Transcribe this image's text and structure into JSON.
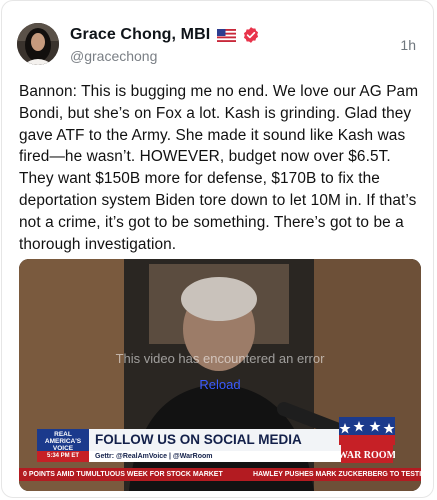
{
  "post": {
    "author_name": "Grace Chong, MBI",
    "handle": "@gracechong",
    "timestamp": "1h",
    "text": "Bannon: This is bugging me no end. We love our AG Pam Bondi, but she’s on Fox a lot. Kash is grinding. Glad they gave ATF to the Army. She made it sound like Kash was fired—he wasn’t. HOWEVER, budget now over $6.5T. They want $150B more for defense, $170B to fix the deportation system Biden tore down to let 10M in. If that’s not a crime, it’s got to be something. There’s got to be a thorough investigation."
  },
  "media": {
    "error_text": "This video has encountered an error",
    "reload_label": "Reload",
    "chyron": {
      "logo_text": "REAL AMERICA'S VOICE",
      "headline": "FOLLOW US ON SOCIAL MEDIA",
      "time": "5:34 PM ET",
      "social": "Gettr: @RealAmVoice  |  @WarRoom",
      "ticker_left": "0 POINTS AMID TUMULTUOUS WEEK FOR STOCK MARKET",
      "ticker_right": "HAWLEY PUSHES MARK ZUCKERBERG TO TESTI",
      "warroom_logo": "WAR ROOM"
    }
  },
  "colors": {
    "verified_badge": "#e8344b",
    "link": "#3b5bff",
    "ticker_red": "#b31b21",
    "chyron_blue": "#1b3a8c"
  },
  "icons": {
    "flag": "us-flag-icon",
    "verified": "verified-badge-icon"
  }
}
